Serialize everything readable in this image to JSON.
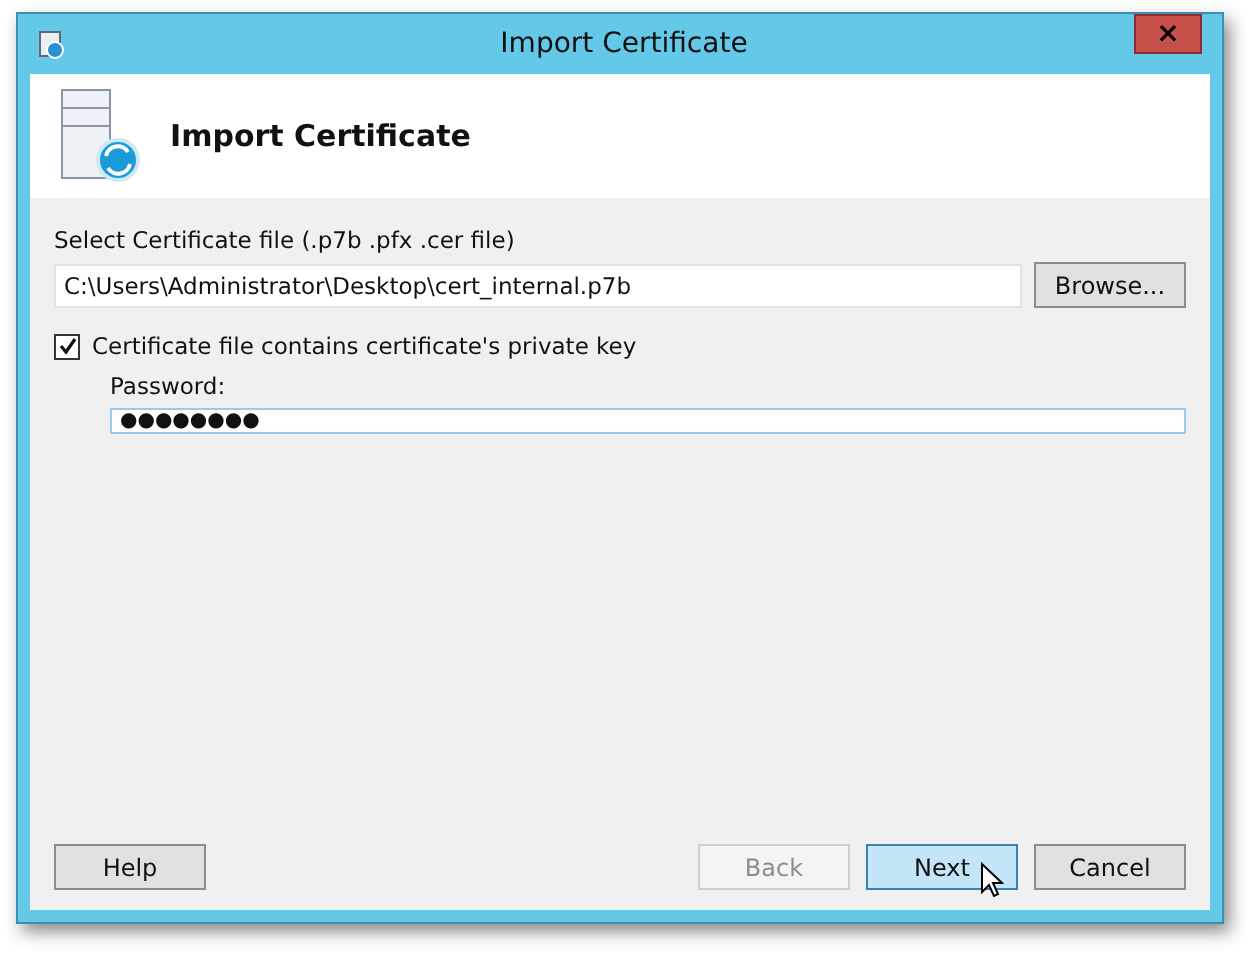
{
  "window": {
    "title": "Import Certificate",
    "close": "×"
  },
  "header": {
    "title": "Import Certificate"
  },
  "file": {
    "label": "Select Certificate file (.p7b .pfx .cer file)",
    "value": "C:\\Users\\Administrator\\Desktop\\cert_internal.p7b",
    "browse": "Browse..."
  },
  "private_key": {
    "label": "Certificate file contains certificate's private key",
    "checked": true
  },
  "password": {
    "label": "Password:",
    "value": "●●●●●●●●"
  },
  "buttons": [
    {
      "label": "Help",
      "kind": "left",
      "disabled": false,
      "selected": false
    },
    {
      "label": "Back",
      "kind": "right",
      "disabled": true,
      "selected": false
    },
    {
      "label": "Next",
      "kind": "right",
      "disabled": false,
      "selected": true
    },
    {
      "label": "Cancel",
      "kind": "right",
      "disabled": false,
      "selected": false
    }
  ]
}
